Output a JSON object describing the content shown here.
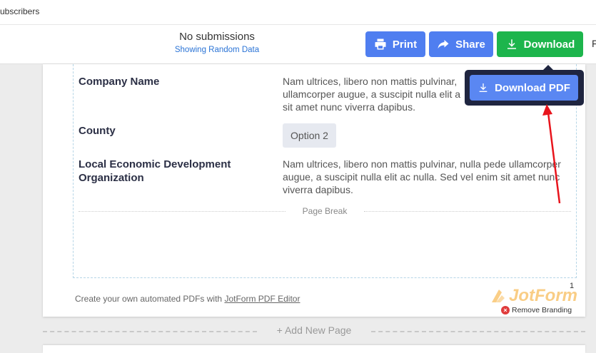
{
  "topbar": {
    "crumb": "ubscribers"
  },
  "toolbar": {
    "status_main": "No submissions",
    "status_link": "Showing Random Data",
    "print_label": "Print",
    "share_label": "Share",
    "download_label": "Download",
    "cut_text": "F"
  },
  "dropdown": {
    "download_pdf_label": "Download PDF"
  },
  "form": {
    "rows": [
      {
        "label": "Company Name",
        "value": "Nam ultrices, libero non mattis pulvinar, nulla pede ullamcorper augue, a suscipit nulla elit ac nulla. Sed vel enim sit amet nunc viverra dapibus."
      },
      {
        "label": "County",
        "value": "Option 2"
      },
      {
        "label": "Local Economic Development Organization",
        "value": "Nam ultrices, libero non mattis pulvinar, nulla pede ullamcorper augue, a suscipit nulla elit ac nulla. Sed vel enim sit amet nunc viverra dapibus."
      }
    ],
    "company_value_visible": "Nam ultrices, libero non mattis pulvinar, ullamcorper augue, a suscipit nulla elit a sit amet nunc viverra dapibus.",
    "page_break": "Page Break",
    "page_number": "1"
  },
  "footer": {
    "note_prefix": "Create your own automated PDFs with ",
    "note_link": "JotForm PDF Editor",
    "brand": "JotForm",
    "remove_branding": "Remove Branding"
  },
  "add_page": "+ Add New Page",
  "colors": {
    "primary": "#4f7ef0",
    "success": "#1db54c",
    "dropdown_bg": "#1f2540",
    "annotation": "#e8141c"
  },
  "icons": {
    "print": "printer-icon",
    "share": "share-arrow-icon",
    "download": "download-icon"
  }
}
